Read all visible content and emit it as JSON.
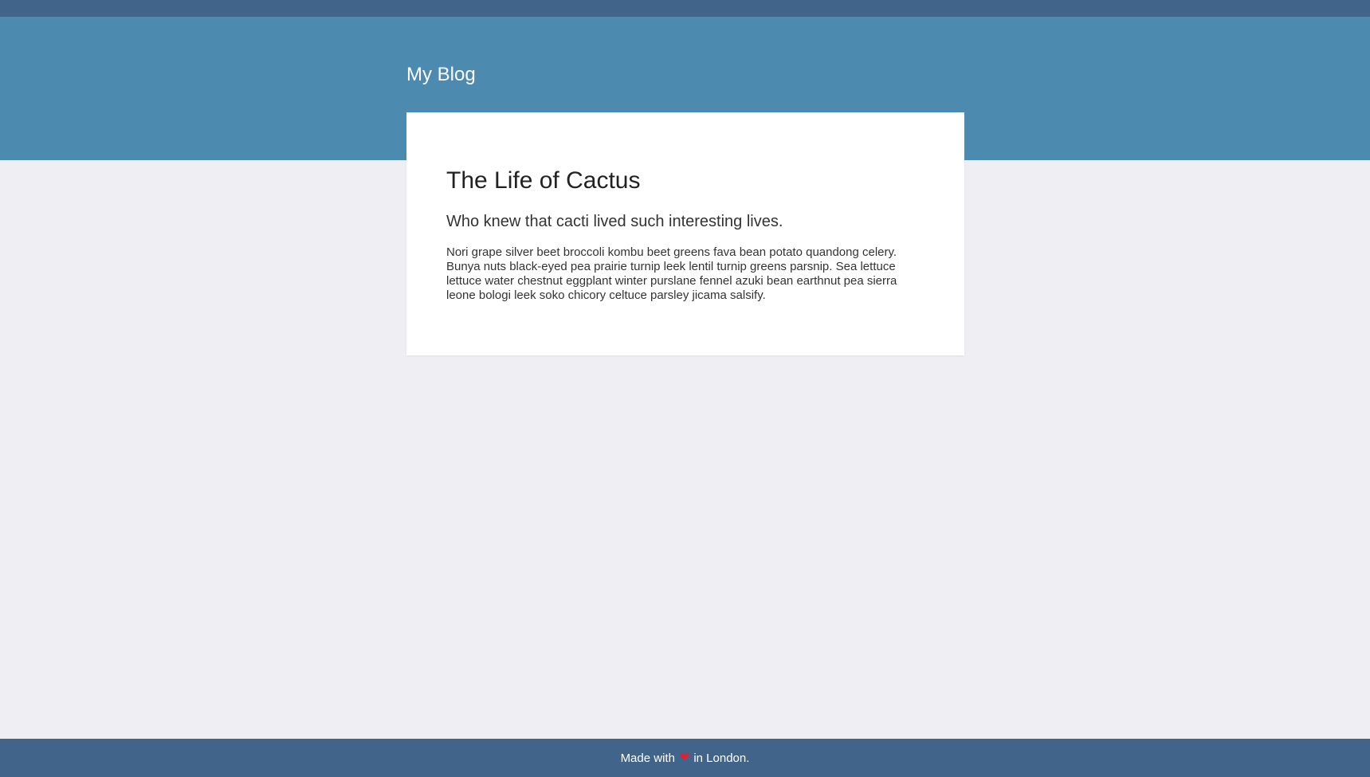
{
  "header": {
    "site_title": "My Blog"
  },
  "post": {
    "title": "The Life of Cactus",
    "subtitle": "Who knew that cacti lived such interesting lives.",
    "body": "Nori grape silver beet broccoli kombu beet greens fava bean potato quandong celery. Bunya nuts black-eyed pea prairie turnip leek lentil turnip greens parsnip. Sea lettuce lettuce water chestnut eggplant winter purslane fennel azuki bean earthnut pea sierra leone bologi leek soko chicory celtuce parsley jicama salsify."
  },
  "footer": {
    "made_with": "Made with",
    "heart_icon": "heart-icon",
    "in_location": "in London."
  },
  "colors": {
    "top_strip": "#41648b",
    "header_band": "#4d8ab0",
    "background": "#efeef3",
    "footer": "#41648b",
    "heart": "#e0202e"
  }
}
